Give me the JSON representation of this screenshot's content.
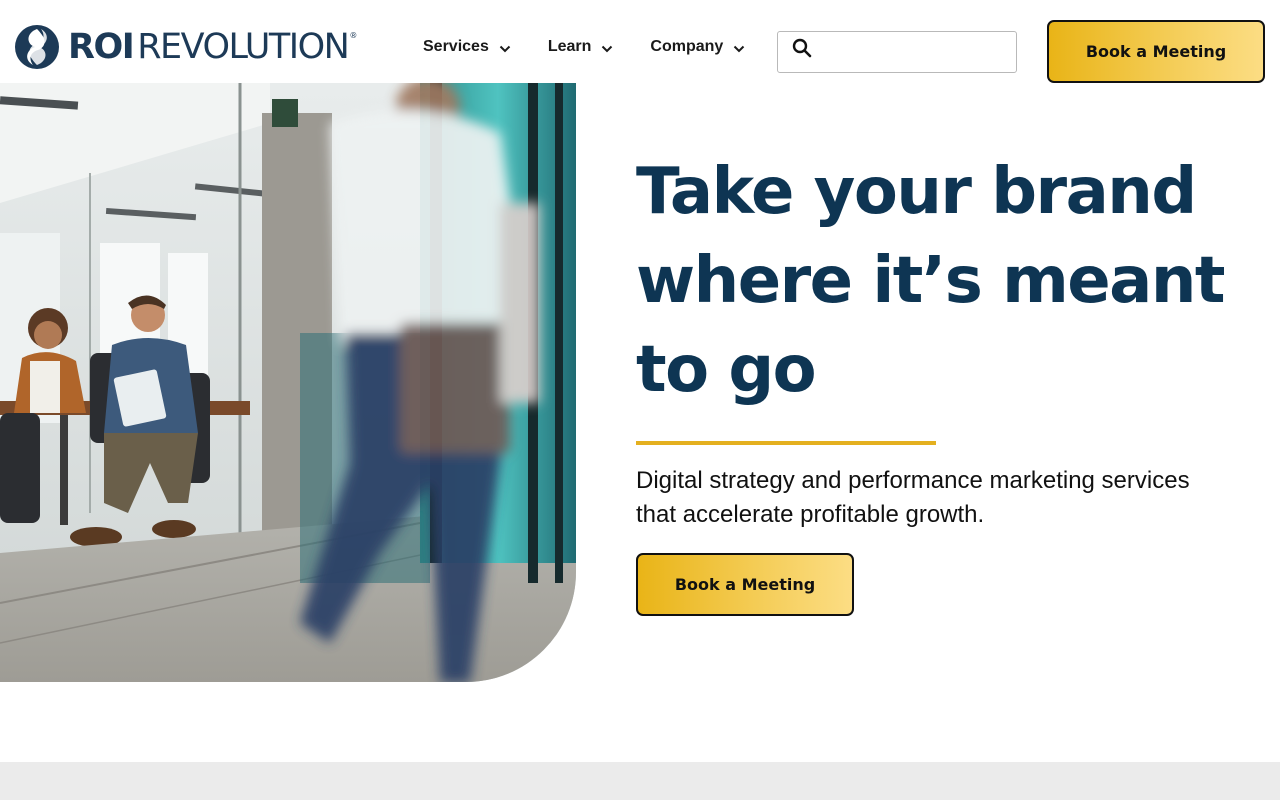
{
  "brand": {
    "name_bold": "ROI",
    "name_regular": "REVOLUTION",
    "registered_mark": "®",
    "primary_color": "#0e3553",
    "accent_color": "#e9b417"
  },
  "nav": {
    "items": [
      {
        "label": "Services",
        "icon": "chevron-down-icon"
      },
      {
        "label": "Learn",
        "icon": "chevron-down-icon"
      },
      {
        "label": "Company",
        "icon": "chevron-down-icon"
      }
    ]
  },
  "search": {
    "icon": "search-icon",
    "placeholder": "",
    "value": ""
  },
  "header": {
    "cta_label": "Book a Meeting"
  },
  "hero": {
    "title_lines": [
      "Take your brand",
      "where it’s meant",
      "to go"
    ],
    "subtitle": "Digital strategy and performance marketing services that accelerate profitable growth.",
    "cta_label": "Book a Meeting"
  }
}
